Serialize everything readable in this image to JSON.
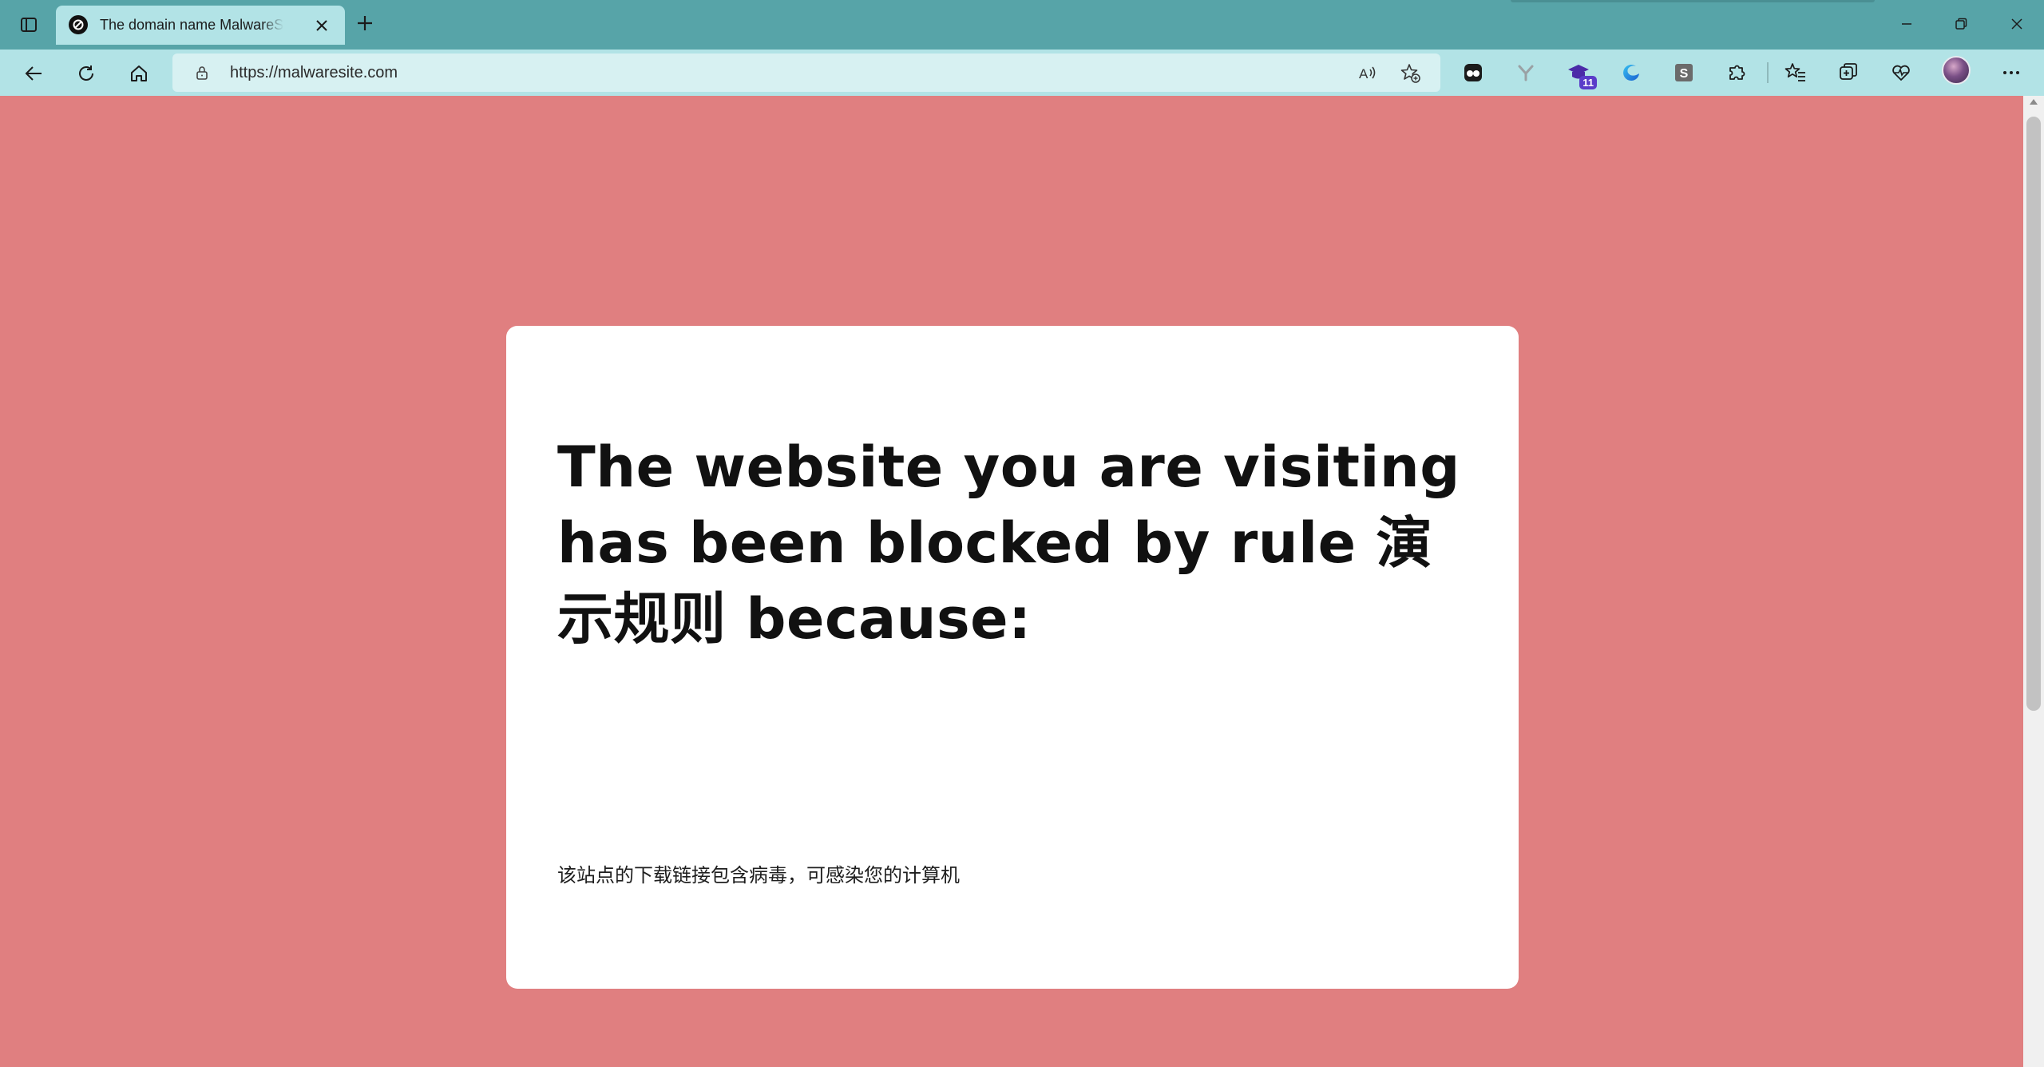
{
  "browser": {
    "tab": {
      "title": "The domain name MalwareSite.com",
      "favicon": "block-icon"
    },
    "address_bar": {
      "url": "https://malwaresite.com"
    },
    "extensions": [
      {
        "name": "tampermonkey-icon"
      },
      {
        "name": "y-extension-icon"
      },
      {
        "name": "graduation-cap-icon",
        "badge": "11"
      },
      {
        "name": "edge-sidebar-icon"
      },
      {
        "name": "s-extension-icon"
      },
      {
        "name": "puzzle-extensions-icon"
      }
    ],
    "colors": {
      "titlebar": "#57a4a8",
      "toolbar": "#b2e3e6",
      "page_background": "#e07f80",
      "card": "#ffffff"
    }
  },
  "page": {
    "headline": "The website you are visiting has been blocked by rule 演示规则 because:",
    "reason": "该站点的下载链接包含病毒，可感染您的计算机"
  }
}
